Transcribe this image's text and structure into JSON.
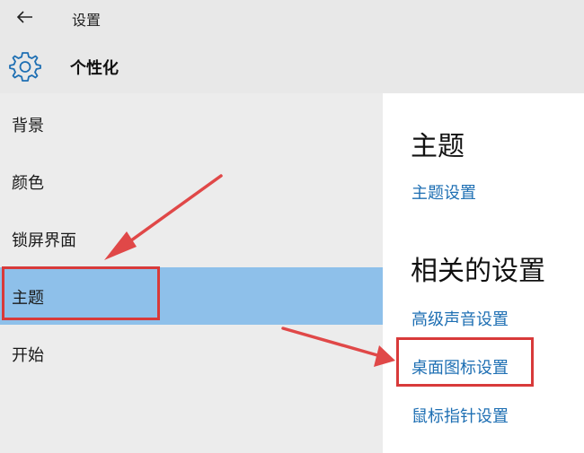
{
  "titlebar": {
    "back_icon": "back-arrow-icon",
    "app_title": "设置"
  },
  "header": {
    "icon": "gear-icon",
    "title": "个性化"
  },
  "sidebar": {
    "selected_index": 3,
    "items": [
      {
        "label": "背景"
      },
      {
        "label": "颜色"
      },
      {
        "label": "锁屏界面"
      },
      {
        "label": "主题"
      },
      {
        "label": "开始"
      }
    ]
  },
  "content": {
    "theme_heading": "主题",
    "theme_settings_link": "主题设置",
    "related_heading": "相关的设置",
    "related_links": [
      {
        "label": "高级声音设置"
      },
      {
        "label": "桌面图标设置"
      },
      {
        "label": "鼠标指针设置"
      }
    ]
  },
  "colors": {
    "selected_bg": "#8ec0ea",
    "link": "#1e6fb3",
    "annotation_red": "#d83a3a"
  }
}
